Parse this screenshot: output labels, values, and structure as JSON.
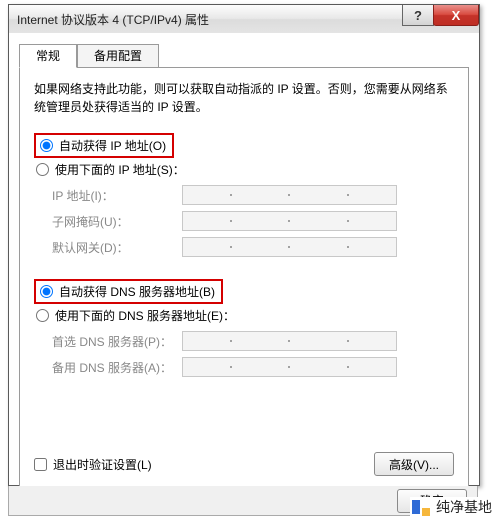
{
  "window": {
    "title": "Internet 协议版本 4 (TCP/IPv4) 属性",
    "help_symbol": "?",
    "close_symbol": "X"
  },
  "tabs": {
    "general": "常规",
    "alternate": "备用配置"
  },
  "description": "如果网络支持此功能，则可以获取自动指派的 IP 设置。否则，您需要从网络系统管理员处获得适当的 IP 设置。",
  "ip_group": {
    "auto": "自动获得 IP 地址(O)",
    "manual": "使用下面的 IP 地址(S)：",
    "selected": "auto",
    "fields": {
      "ip": "IP 地址(I)：",
      "subnet": "子网掩码(U)：",
      "gateway": "默认网关(D)："
    }
  },
  "dns_group": {
    "auto": "自动获得 DNS 服务器地址(B)",
    "manual": "使用下面的 DNS 服务器地址(E)：",
    "selected": "auto",
    "fields": {
      "pref": "首选 DNS 服务器(P)：",
      "alt": "备用 DNS 服务器(A)："
    }
  },
  "validate_label": "退出时验证设置(L)",
  "advanced_label": "高级(V)...",
  "buttons": {
    "ok": "确定"
  },
  "watermark": "纯净基地"
}
